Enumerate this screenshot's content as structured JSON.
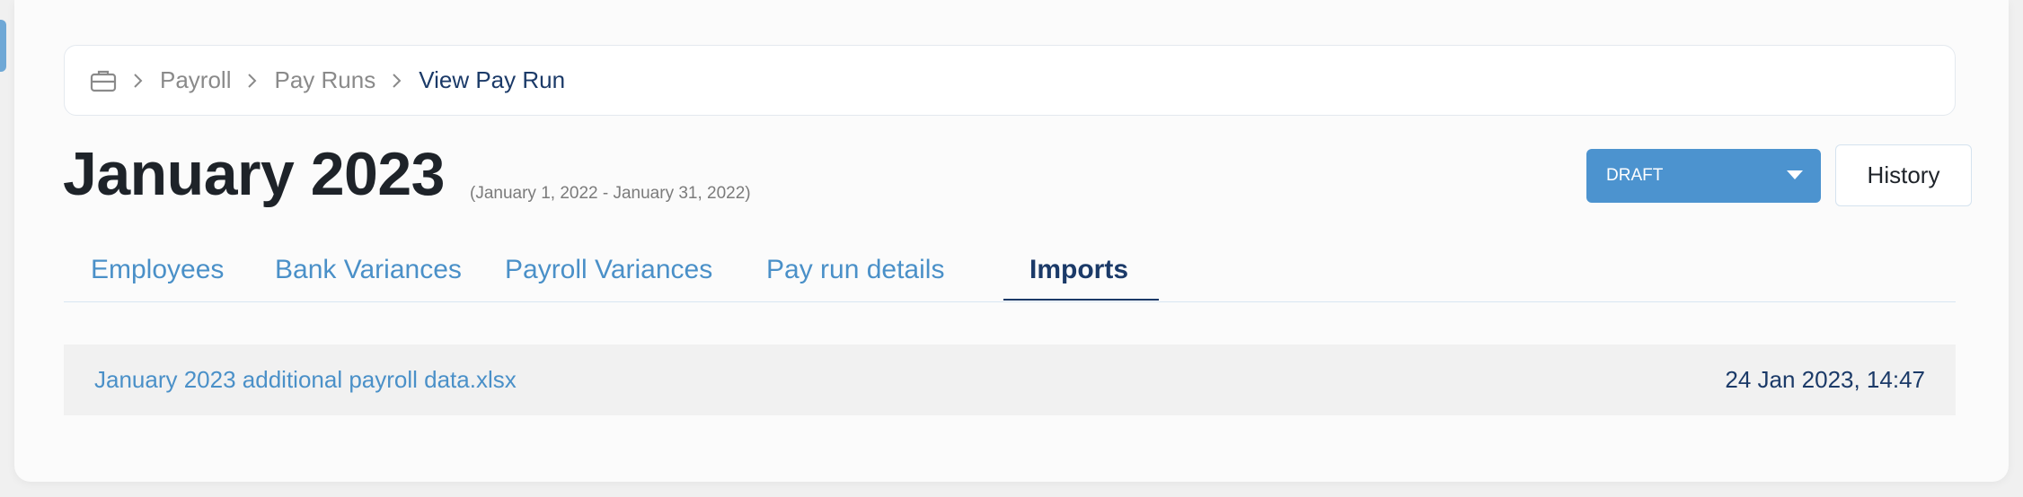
{
  "breadcrumb": {
    "icon": "briefcase-icon",
    "items": [
      "Payroll",
      "Pay Runs",
      "View Pay Run"
    ]
  },
  "header": {
    "title": "January 2023",
    "period": "(January 1, 2022 - January 31, 2022)"
  },
  "status": {
    "selected": "DRAFT",
    "color": "#4c93cf"
  },
  "history_label": "History",
  "tabs": [
    {
      "label": "Employees"
    },
    {
      "label": "Bank Variances"
    },
    {
      "label": "Payroll Variances"
    },
    {
      "label": "Pay run details"
    },
    {
      "label": "Imports",
      "active": true
    }
  ],
  "imports": [
    {
      "file": "January 2023 additional payroll data.xlsx",
      "date": "24 Jan 2023, 14:47"
    }
  ],
  "colors": {
    "accent": "#4a90c8",
    "navy": "#1b3a68"
  }
}
